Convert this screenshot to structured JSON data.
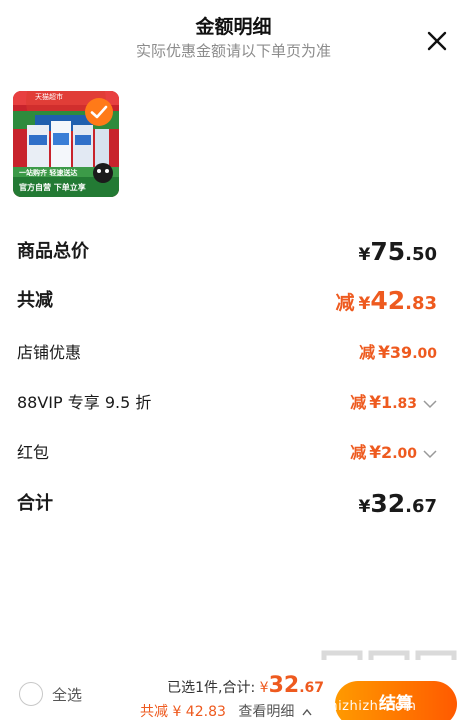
{
  "header": {
    "title": "金额明细",
    "subtitle": "实际优惠金额请以下单页为准"
  },
  "product": {
    "badge_top": "天猫超市",
    "banner_line1": "一站购齐 轻速送达",
    "banner_line2": "官方自营 下单立享"
  },
  "rows": [
    {
      "label": "商品总价",
      "prefix": "",
      "currency": "¥",
      "int": "75",
      "dec": ".50",
      "style": "big",
      "color": "black",
      "chevron": false
    },
    {
      "label": "共减",
      "prefix": "减",
      "currency": "¥",
      "int": "42",
      "dec": ".83",
      "style": "big",
      "color": "orange",
      "chevron": false
    },
    {
      "label": "店铺优惠",
      "prefix": "减",
      "currency": "¥",
      "int": "39",
      "dec": ".00",
      "style": "small",
      "color": "orange",
      "chevron": false
    },
    {
      "label": "88VIP 专享 9.5 折",
      "prefix": "减",
      "currency": "¥",
      "int": "1",
      "dec": ".83",
      "style": "small",
      "color": "orange",
      "chevron": true
    },
    {
      "label": "红包",
      "prefix": "减",
      "currency": "¥",
      "int": "2",
      "dec": ".00",
      "style": "small",
      "color": "orange",
      "chevron": true
    },
    {
      "label": "合计",
      "prefix": "",
      "currency": "¥",
      "int": "32",
      "dec": ".67",
      "style": "big",
      "color": "black",
      "chevron": false
    }
  ],
  "bottom": {
    "select_all": "全选",
    "selected_text": "已选1件,",
    "total_label": "合计:",
    "total_currency": "¥",
    "total_int": "32",
    "total_dec": ".67",
    "discount_text": "共减 ¥ 42.83",
    "details_text": "查看明细",
    "checkout": "结算"
  },
  "watermark": {
    "text": "zhizhizhi.com"
  },
  "colors": {
    "accent": "#ee5a1f",
    "checkout_start": "#ff9a00",
    "checkout_end": "#ff5a00"
  }
}
